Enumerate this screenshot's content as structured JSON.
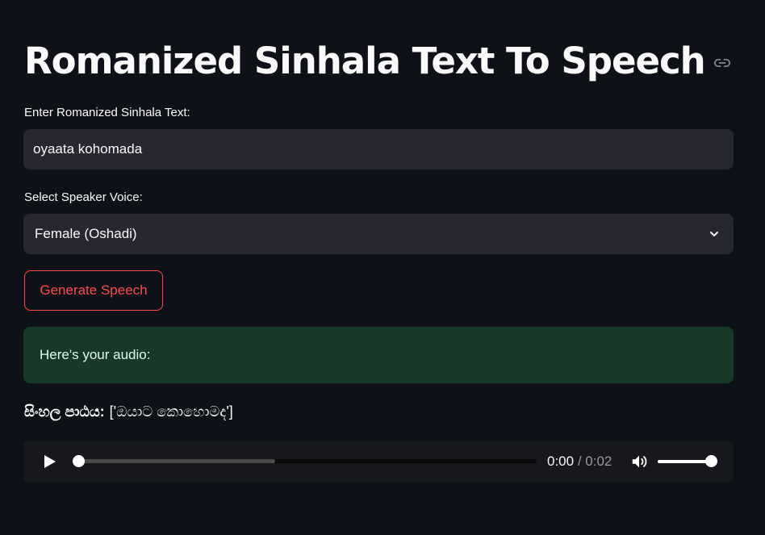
{
  "header": {
    "title": "Romanized Sinhala Text To Speech",
    "anchor_icon": "link-icon"
  },
  "text_input": {
    "label": "Enter Romanized Sinhala Text:",
    "value": "oyaata kohomada"
  },
  "voice_select": {
    "label": "Select Speaker Voice:",
    "selected": "Female (Oshadi)",
    "icon": "chevron-down-icon"
  },
  "generate_button": {
    "label": "Generate Speech"
  },
  "success_message": {
    "text": "Here's your audio:"
  },
  "sinhala_output": {
    "label": "සිංහල පාඨය:",
    "value": "['ඔයාට කොහොමද']"
  },
  "audio_player": {
    "current_time": "0:00",
    "separator": "/",
    "duration": "0:02",
    "progress": 0,
    "buffered": 0.43,
    "volume": 1.0
  },
  "colors": {
    "background": "#0e1117",
    "input_bg": "#262730",
    "accent": "#ff4b4b",
    "success_bg": "#173928",
    "success_text": "#dffde9"
  }
}
